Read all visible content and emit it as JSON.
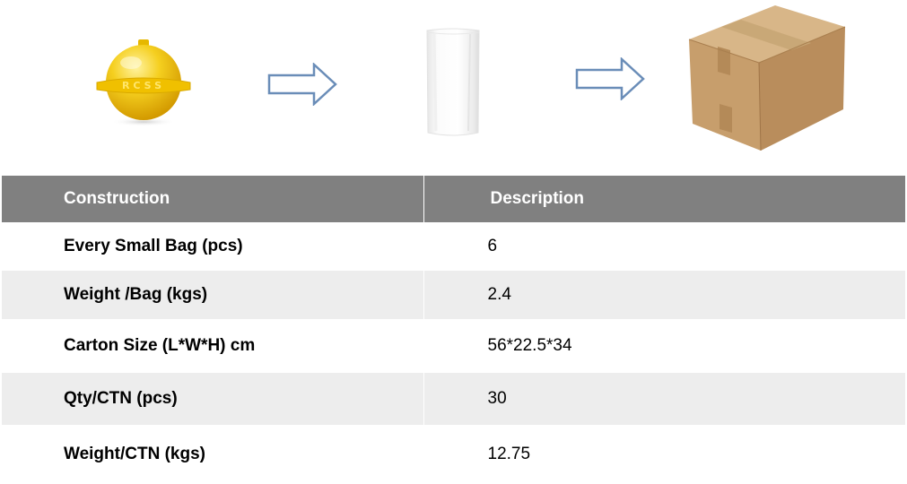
{
  "images": {
    "ball": {
      "icon": "yellow-marker-ball",
      "color": "#f2c81a",
      "logo_text": "RCSS"
    },
    "arrow1": {
      "icon": "right-arrow-outline",
      "color": "#6a8db8"
    },
    "bag": {
      "icon": "white-plastic-bag"
    },
    "arrow2": {
      "icon": "right-arrow-outline",
      "color": "#6a8db8"
    },
    "box": {
      "icon": "cardboard-carton",
      "color": "#c9a273"
    }
  },
  "table": {
    "header": {
      "construction": "Construction",
      "description": "Description"
    },
    "rows": [
      {
        "label": "Every Small Bag (pcs)",
        "value": "6"
      },
      {
        "label": "Weight /Bag (kgs)",
        "value": "2.4"
      },
      {
        "label": "Carton Size (L*W*H) cm",
        "value": "56*22.5*34"
      },
      {
        "label": "Qty/CTN (pcs)",
        "value": "30"
      },
      {
        "label": "Weight/CTN (kgs)",
        "value": "12.75"
      }
    ],
    "colors": {
      "header_bg": "#808080",
      "header_text": "#ffffff",
      "stripe_bg": "#ededed"
    }
  }
}
